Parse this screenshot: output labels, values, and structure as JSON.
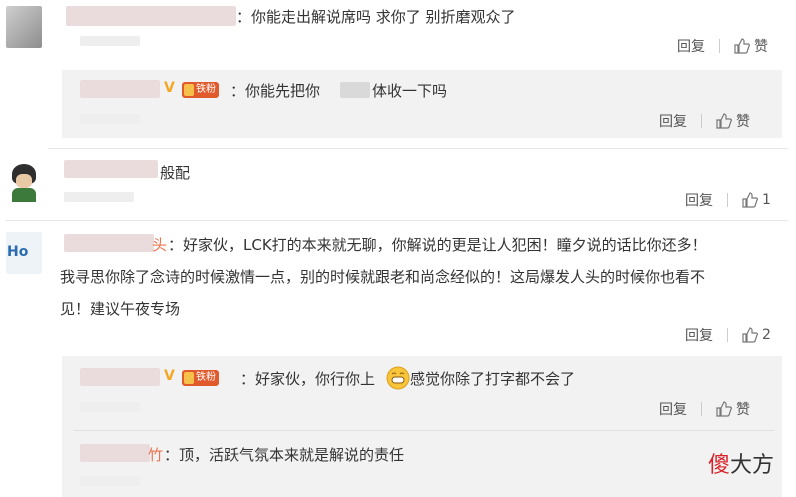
{
  "comments": [
    {
      "text": "：你能走出解说席吗 求你了 别折磨观众了",
      "actions": {
        "reply": "回复",
        "like": "赞"
      }
    },
    {
      "is_reply": true,
      "text": "：你能先把你",
      "text_tail": "体收一下吗",
      "vip": "V",
      "badge": "铁粉",
      "actions": {
        "reply": "回复",
        "like": "赞"
      }
    },
    {
      "text": "般配",
      "actions": {
        "reply": "回复",
        "like": "1"
      }
    },
    {
      "name_tail": "头",
      "avatar_text": "Ho",
      "lines": [
        "：好家伙，LCK打的本来就无聊，你解说的更是让人犯困！瞳夕说的话比你还多！",
        "我寻思你除了念诗的时候激情一点，别的时候就跟老和尚念经似的！这局爆发人头的时候你也看不",
        "见！建议午夜专场"
      ],
      "actions": {
        "reply": "回复",
        "like": "2"
      }
    },
    {
      "is_reply": true,
      "text": "：好家伙，你行你上",
      "text_tail": "感觉你除了打字都不会了",
      "vip": "V",
      "badge": "铁粉",
      "actions": {
        "reply": "回复",
        "like": "赞"
      }
    },
    {
      "is_reply": true,
      "name_tail": "竹",
      "text": "：顶，活跃气氛本来就是解说的责任"
    }
  ],
  "watermark": {
    "red": "傻",
    "rest": "大方"
  },
  "colors": {
    "vip": "#f5a623",
    "badge": "#e05a2b",
    "reply_bg": "#f2f2f2",
    "watermark_red": "#d9232b"
  }
}
